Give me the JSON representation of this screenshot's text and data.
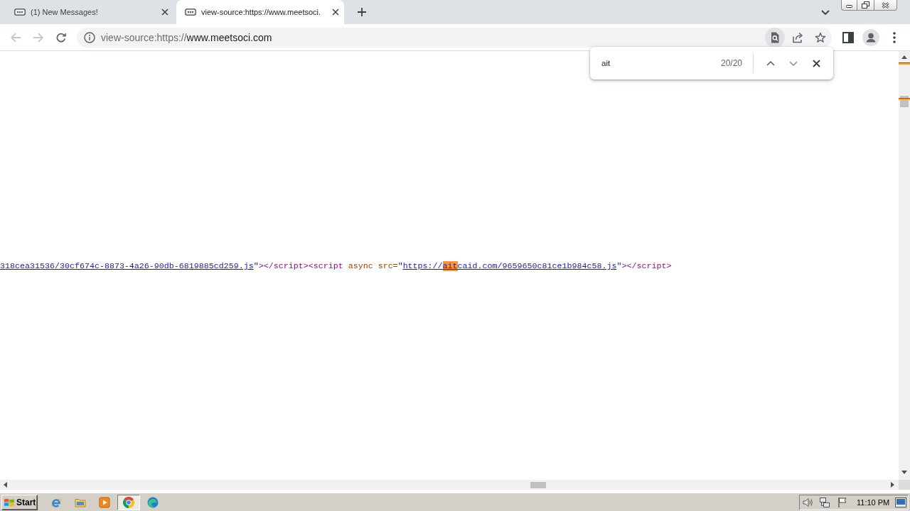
{
  "tab_strip": {
    "tabs": [
      {
        "title": "(1) New Messages!",
        "selected": false
      },
      {
        "title": "view-source:https://www.meetsoci.",
        "selected": true
      }
    ]
  },
  "toolbar": {
    "nav_buttons": [
      {
        "kind": "back",
        "disabled": true
      },
      {
        "kind": "forward",
        "disabled": true
      },
      {
        "kind": "reload",
        "disabled": false
      }
    ],
    "address": {
      "scheme": "view-source:https://",
      "host": "www.meetsoci.com"
    },
    "find_button_active": true
  },
  "find_bar": {
    "query": "ait",
    "count": "20/20",
    "buttons": [
      {
        "kind": "previous",
        "disabled": false
      },
      {
        "kind": "next",
        "disabled": true
      }
    ]
  },
  "source_line": [
    {
      "kind": "link",
      "parts": [
        {
          "text": "318cea31536/30cf674c-8873-4a26-90db-6819885cd259.js",
          "match": false
        }
      ]
    },
    {
      "kind": "quote",
      "text": "\""
    },
    {
      "kind": "tag",
      "text": "></script><script"
    },
    {
      "kind": "attribute",
      "text": " async src="
    },
    {
      "kind": "quote",
      "text": "\""
    },
    {
      "kind": "link",
      "parts": [
        {
          "text": "https://",
          "match": false
        },
        {
          "text": "ait",
          "match": true
        },
        {
          "text": "caid.com/9659650c81ce1b984c58.js",
          "match": false
        }
      ]
    },
    {
      "kind": "quote",
      "text": "\""
    },
    {
      "kind": "tag",
      "text": "></script>"
    }
  ],
  "taskbar": {
    "start": "Start",
    "apps": [
      {
        "kind": "e-logo",
        "selected": false
      },
      {
        "kind": "folder",
        "selected": false
      },
      {
        "kind": "player",
        "selected": false
      },
      {
        "kind": "ring-logo",
        "selected": true
      },
      {
        "kind": "swirl-logo",
        "selected": false
      }
    ],
    "clock": "11:10 PM"
  }
}
